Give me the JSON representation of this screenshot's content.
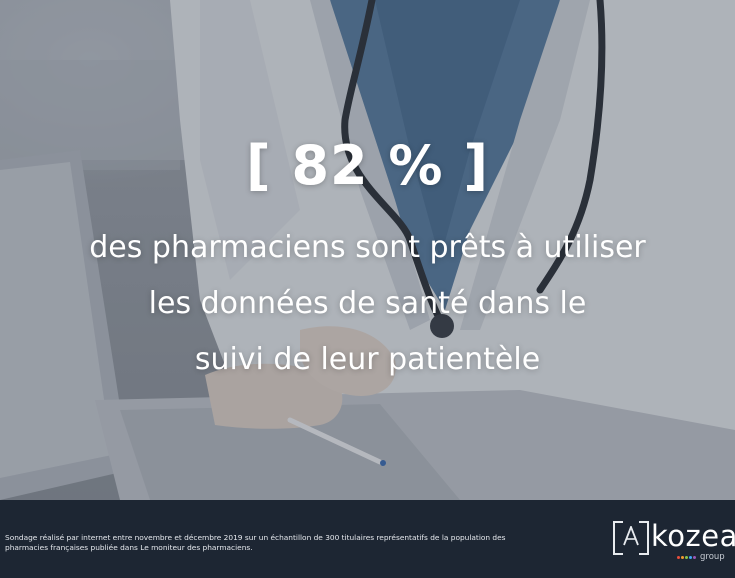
{
  "headline": {
    "stat": "[ 82 % ]",
    "lines": [
      "des pharmaciens sont prêts à utiliser",
      "les données de santé dans le",
      "suivi de leur patientèle"
    ]
  },
  "footer": {
    "source_lines": [
      "Sondage réalisé par internet entre novembre et décembre 2019 sur un échantillon de 300 titulaires représentatifs de la population des",
      "pharmacies françaises publiée dans Le moniteur des pharmaciens."
    ]
  },
  "logo": {
    "mark": "A",
    "wordmark": "kozea",
    "sub": "group",
    "dot_colors": [
      "#e94e3c",
      "#f29a2e",
      "#8bc34a",
      "#3fa9f5",
      "#9b59b6"
    ]
  },
  "colors": {
    "footer_bg": "#1d2633",
    "headline_text": "#ffffff",
    "scrubs": "#5a7fa3",
    "coat": "#e9ecef"
  },
  "background_image": "doctor in white coat with stethoscope typing on a laptop"
}
